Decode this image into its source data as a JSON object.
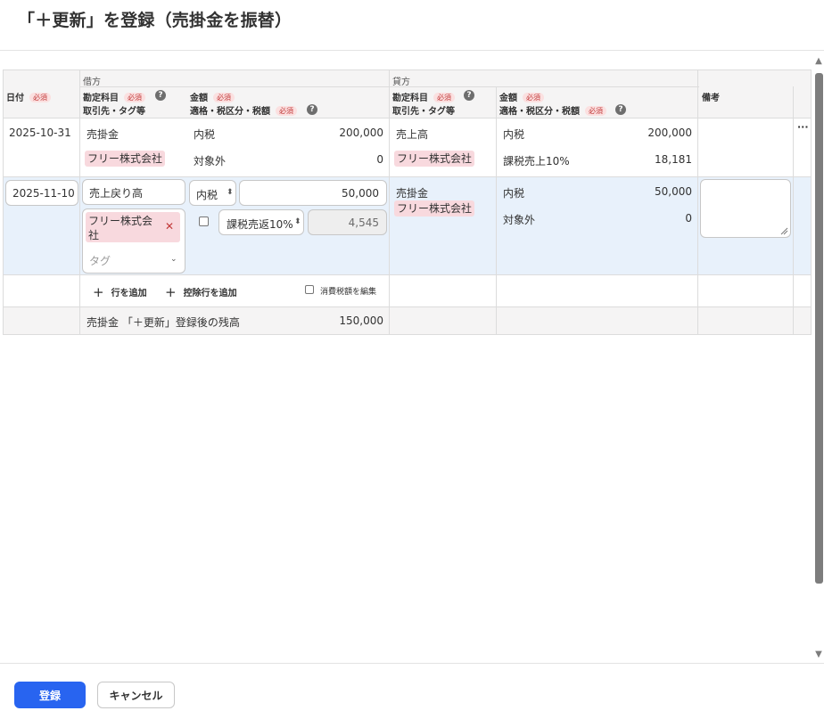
{
  "dialog": {
    "title": "「＋更新」を登録（売掛金を振替）"
  },
  "table": {
    "header": {
      "debit_group": "借方",
      "credit_group": "貸方",
      "date": "日付",
      "required": "必須",
      "account": "勘定科目",
      "partner_tag": "取引先・タグ等",
      "amount": "金額",
      "price_tax": "適格・税区分・税額",
      "memo": "備考"
    },
    "row1": {
      "date": "2025-10-31",
      "debit_account": "売掛金",
      "debit_partner": "フリー株式会社",
      "debit_tax1": "内税",
      "debit_amount1": "200,000",
      "debit_tax2": "対象外",
      "debit_amount2": "0",
      "credit_account": "売上高",
      "credit_partner": "フリー株式会社",
      "credit_tax1": "内税",
      "credit_amount1": "200,000",
      "credit_tax2": "課税売上10%",
      "credit_amount2": "18,181",
      "more": "···"
    },
    "row2": {
      "date": "2025-11-10",
      "debit_account": "売上戻り高",
      "debit_partner": "フリー株式会社",
      "remove": "✕",
      "tag_placeholder": "タグ",
      "tax_mode": "内税",
      "amount": "50,000",
      "tax_category": "課税売返10%",
      "tax_amount": "4,545",
      "credit_account": "売掛金",
      "credit_partner": "フリー株式会社",
      "credit_tax1": "内税",
      "credit_amount1": "50,000",
      "credit_tax2": "対象外",
      "credit_amount2": "0"
    },
    "actions": {
      "add_row": "行を追加",
      "add_deduction_row": "控除行を追加",
      "edit_tax": "消費税額を編集"
    },
    "balance": {
      "label": "売掛金 「＋更新」登録後の残高",
      "value": "150,000"
    }
  },
  "footer": {
    "submit": "登録",
    "cancel": "キャンセル"
  },
  "colors": {
    "primary": "#2864f0",
    "tag_bg": "#f8d9de",
    "required_bg": "#fbe0e0",
    "selected_row": "#e8f1fb"
  },
  "icons": {
    "help": "question-circle-icon",
    "chevron": "chevron-down-icon",
    "plus": "plus-icon",
    "close": "close-icon"
  }
}
